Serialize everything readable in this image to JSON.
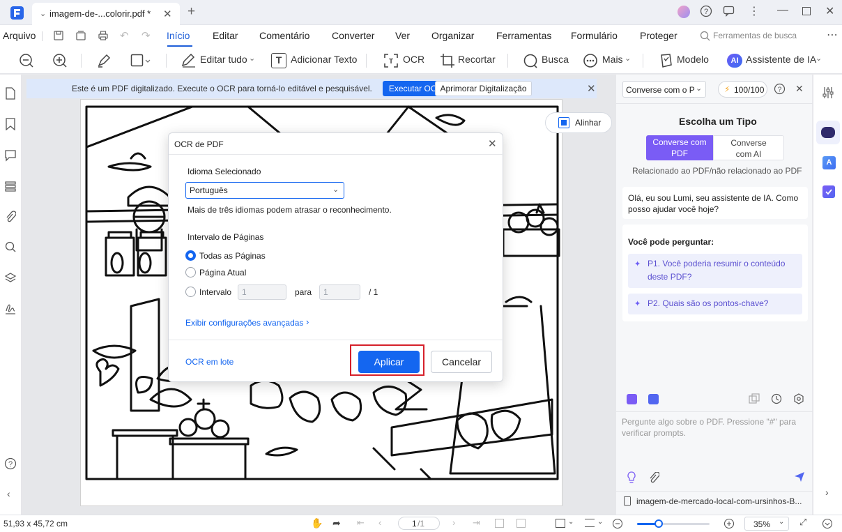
{
  "titlebar": {
    "tab_title": "imagem-de-...colorir.pdf *"
  },
  "menu": {
    "items": [
      "Arquivo",
      "Início",
      "Editar",
      "Comentário",
      "Converter",
      "Ver",
      "Organizar",
      "Ferramentas",
      "Formulário",
      "Proteger"
    ],
    "active": "Início",
    "search_placeholder": "Ferramentas de busca"
  },
  "toolbar": {
    "edit_all": "Editar tudo",
    "add_text": "Adicionar Texto",
    "ocr": "OCR",
    "crop": "Recortar",
    "search": "Busca",
    "more": "Mais",
    "template": "Modelo",
    "ai_assistant": "Assistente de IA",
    "ai_badge": "AI"
  },
  "banner": {
    "text": "Este é um PDF digitalizado. Execute o OCR para torná-lo editável e pesquisável.",
    "run_ocr": "Executar OCR",
    "enhance": "Aprimorar Digitalização"
  },
  "align_button": "Alinhar",
  "dialog": {
    "title": "OCR de PDF",
    "language_label": "Idioma Selecionado",
    "language_value": "Português",
    "language_note": "Mais de três idiomas podem atrasar o reconhecimento.",
    "range_label": "Intervalo de Páginas",
    "opt_all": "Todas as Páginas",
    "opt_current": "Página Atual",
    "opt_range": "Intervalo",
    "range_from": "1",
    "range_to_label": "para",
    "range_to": "1",
    "range_total": "/ 1",
    "advanced": "Exibir configurações avançadas",
    "batch": "OCR em lote",
    "apply": "Aplicar",
    "cancel": "Cancelar"
  },
  "ai_panel": {
    "mode_select": "Converse com o P",
    "credits": "100/100",
    "choose_type": "Escolha um Tipo",
    "type_pdf": "Converse com PDF",
    "type_ai": "Converse com AI",
    "type_note": "Relacionado ao PDF/não relacionado ao PDF",
    "greeting": "Olá, eu sou Lumi, seu assistente de IA. Como posso ajudar você hoje?",
    "you_can_ask": "Você pode perguntar:",
    "prompt1": "P1. Você poderia resumir o conteúdo deste PDF?",
    "prompt2": "P2. Quais são os pontos-chave?",
    "input_placeholder": "Pergunte algo sobre o PDF. Pressione \"#\" para verificar prompts.",
    "file_name": "imagem-de-mercado-local-com-ursinhos-B..."
  },
  "status": {
    "dimensions": "51,93 x 45,72 cm",
    "page": "1",
    "page_total": "/1",
    "zoom": "35%"
  },
  "colors": {
    "accent": "#1466f0",
    "highlight_border": "#d6202a",
    "ai_purple": "#5a4fd0"
  }
}
